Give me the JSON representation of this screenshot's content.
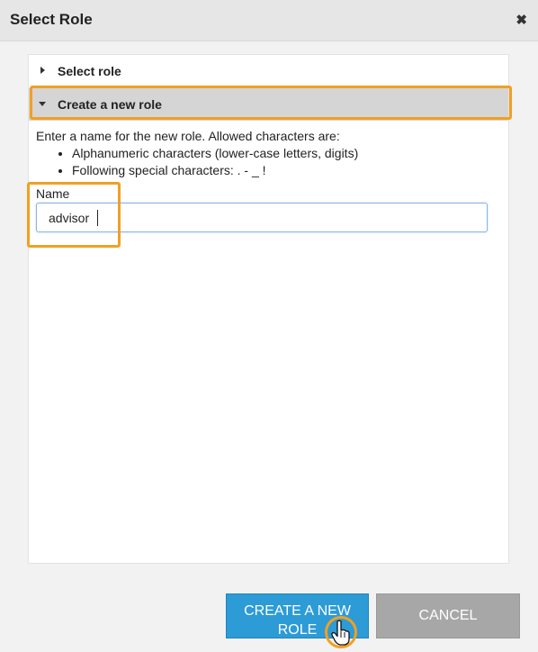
{
  "dialog": {
    "title": "Select Role",
    "close_glyph": "✖"
  },
  "accordion": [
    {
      "label": "Select role",
      "state": "collapsed",
      "icon": "caret-right-icon"
    },
    {
      "label": "Create a new role",
      "state": "expanded",
      "icon": "caret-down-icon"
    }
  ],
  "create_section": {
    "intro": "Enter a name for the new role. Allowed characters are:",
    "rules": [
      "Alphanumeric characters (lower-case letters, digits)",
      "Following special characters: . - _ !"
    ],
    "name_label": "Name",
    "name_value": "advisor"
  },
  "buttons": {
    "create_label": "CREATE A NEW ROLE",
    "cancel_label": "CANCEL"
  },
  "colors": {
    "highlight": "#f0a023",
    "primary_button": "#2c9bd6",
    "cancel_button": "#a7a7a7",
    "expanded_header": "#d5d5d5"
  }
}
